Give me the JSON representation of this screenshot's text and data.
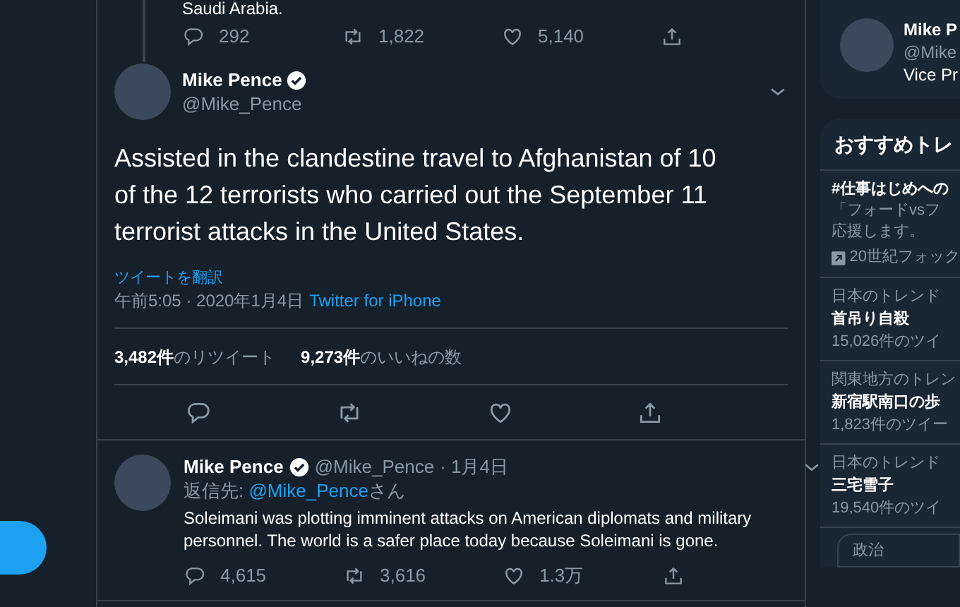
{
  "previous_tweet": {
    "text_fragment": "Saudi Arabia.",
    "actions": [
      {
        "kind": "reply",
        "count": "292"
      },
      {
        "kind": "retweet",
        "count": "1,822"
      },
      {
        "kind": "like",
        "count": "5,140"
      },
      {
        "kind": "share"
      }
    ]
  },
  "main_tweet": {
    "name": "Mike Pence",
    "verified": true,
    "handle": "@Mike_Pence",
    "text": "Assisted in the clandestine travel to Afghanistan of 10 of the 12 terrorists who carried out the September 11 terrorist attacks in the United States.",
    "translate": "ツイートを翻訳",
    "time": "午前5:05 · 2020年1月4日",
    "source": "Twitter for iPhone",
    "stats": [
      {
        "count": "3,482件",
        "label": "のリツイート"
      },
      {
        "count": "9,273件",
        "label": "のいいねの数"
      }
    ],
    "actions": [
      {
        "kind": "reply"
      },
      {
        "kind": "retweet"
      },
      {
        "kind": "like"
      },
      {
        "kind": "share"
      }
    ]
  },
  "reply_tweet": {
    "name": "Mike Pence",
    "verified": true,
    "handle": "@Mike_Pence",
    "date": "· 1月4日",
    "reply_prefix": "返信先:",
    "reply_to": "@Mike_Pence",
    "reply_suffix": "さん",
    "text": "Soleimani was plotting imminent attacks on American diplomats and military personnel. The world is a safer place today because Soleimani is gone.",
    "actions": [
      {
        "kind": "reply",
        "count": "4,615"
      },
      {
        "kind": "retweet",
        "count": "3,616"
      },
      {
        "kind": "like",
        "count": "1.3万"
      },
      {
        "kind": "share"
      }
    ]
  },
  "profile_card": {
    "name": "Mike P",
    "handle": "@Mike",
    "bio": "Vice Pr"
  },
  "trends": {
    "title": "おすすめトレ",
    "items": [
      {
        "kind": "promoted",
        "name": "#仕事はじめへの",
        "description_lines": [
          "「フォードvsフ",
          "応援します。"
        ],
        "promoter": "20世紀フォック"
      },
      {
        "kind": "trend",
        "context": "日本のトレンド",
        "name": "首吊り自殺",
        "count": "15,026件のツイ"
      },
      {
        "kind": "trend",
        "context": "関東地方のトレン",
        "name": "新宿駅南口の歩",
        "count": "1,823件のツイー"
      },
      {
        "kind": "trend",
        "context": "日本のトレンド",
        "name": "三宅雪子",
        "count": "19,540件のツイ"
      },
      {
        "kind": "topic",
        "name": "政治"
      }
    ]
  }
}
